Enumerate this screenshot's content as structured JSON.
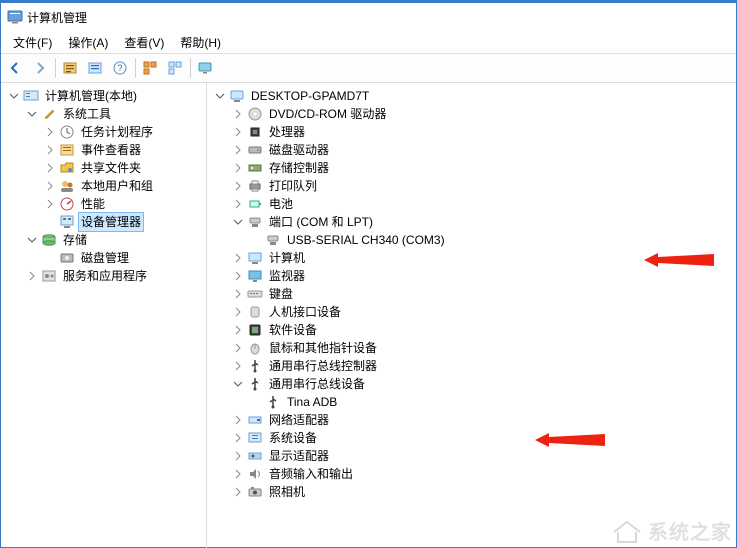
{
  "title": "计算机管理",
  "menu": {
    "file": "文件(F)",
    "action": "操作(A)",
    "view": "查看(V)",
    "help": "帮助(H)"
  },
  "left_tree": {
    "root": {
      "label": "计算机管理(本地)"
    },
    "system_tools": {
      "label": "系统工具",
      "children": {
        "task_scheduler": "任务计划程序",
        "event_viewer": "事件查看器",
        "shared_folders": "共享文件夹",
        "local_users": "本地用户和组",
        "performance": "性能",
        "device_manager": "设备管理器"
      }
    },
    "storage": {
      "label": "存储",
      "children": {
        "disk_mgmt": "磁盘管理"
      }
    },
    "services": {
      "label": "服务和应用程序"
    }
  },
  "right_tree": {
    "root": "DESKTOP-GPAMD7T",
    "dvd": "DVD/CD-ROM 驱动器",
    "cpu": "处理器",
    "disk_drives": "磁盘驱动器",
    "storage_ctrl": "存储控制器",
    "print_queues": "打印队列",
    "battery": "电池",
    "ports": "端口 (COM 和 LPT)",
    "ports_child": "USB-SERIAL CH340 (COM3)",
    "computer": "计算机",
    "monitors": "监视器",
    "keyboards": "键盘",
    "hid": "人机接口设备",
    "software_dev": "软件设备",
    "mice": "鼠标和其他指针设备",
    "usb_ctrl": "通用串行总线控制器",
    "usb_dev": "通用串行总线设备",
    "usb_dev_child": "Tina ADB",
    "net": "网络适配器",
    "sys_dev": "系统设备",
    "display": "显示适配器",
    "audio": "音频输入和输出",
    "camera": "照相机"
  },
  "watermark": "系统之家"
}
